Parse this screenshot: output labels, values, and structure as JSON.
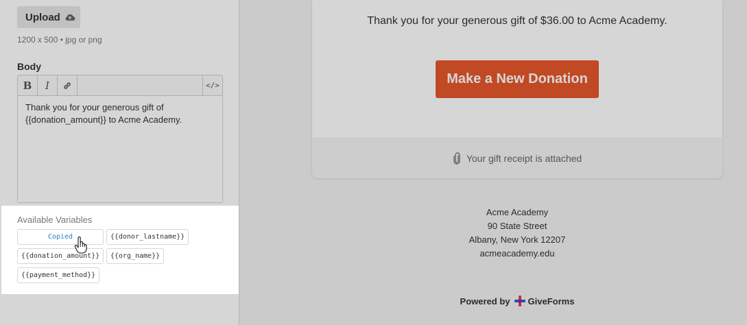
{
  "editor": {
    "upload_label": "Upload",
    "image_hint": "1200 x 500  •  jpg or png",
    "body_label": "Body",
    "toolbar": {
      "bold": "B",
      "italic": "I",
      "code": "</>"
    },
    "body_line1": "Thank you for your generous gift of",
    "body_line2": "{{donation_amount}} to Acme Academy."
  },
  "variables": {
    "title": "Available Variables",
    "chips": [
      {
        "label": "Copied",
        "state": "copied"
      },
      {
        "label": "{{donor_lastname}}"
      },
      {
        "label": "{{donation_amount}}"
      },
      {
        "label": "{{org_name}}"
      },
      {
        "label": "{{payment_method}}"
      }
    ]
  },
  "preview": {
    "message": "Thank you for your generous gift of $36.00 to Acme Academy.",
    "donate_button": "Make a New Donation",
    "receipt_note": "Your gift receipt is attached",
    "address": {
      "name": "Acme Academy",
      "street": "90 State Street",
      "city": "Albany, New York 12207",
      "website": "acmeacademy.edu"
    },
    "powered_by": "Powered by",
    "brand": "GiveForms"
  },
  "colors": {
    "accent_button": "#e6572c",
    "copied_text": "#2a7cc7"
  },
  "icons": [
    "cloud-upload-icon",
    "link-icon",
    "code-icon",
    "paperclip-icon",
    "giveforms-logo-icon",
    "hand-pointer-cursor-icon"
  ]
}
